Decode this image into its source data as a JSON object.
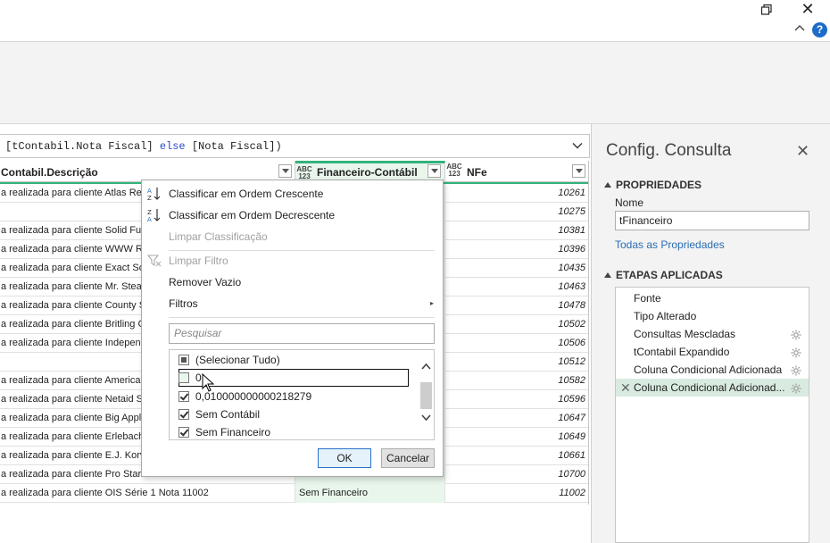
{
  "window": {
    "help_label": "?"
  },
  "formula": {
    "before": "[tContabil.Nota Fiscal] ",
    "keyword": "else",
    "after": " [Nota Fiscal])"
  },
  "grid": {
    "columns": [
      {
        "title": "Contabil.Descrição",
        "type": ""
      },
      {
        "title": "Financeiro-Contábil",
        "type_top": "ABC",
        "type_bottom": "123"
      },
      {
        "title": "NFe",
        "type_top": "ABC",
        "type_bottom": "123"
      }
    ],
    "rows": [
      {
        "desc": "a realizada para cliente Atlas Rea",
        "fin": "",
        "nfe": "10261"
      },
      {
        "desc": "",
        "fin": "",
        "nfe": "10275"
      },
      {
        "desc": "a realizada para cliente Solid Fut",
        "fin": "",
        "nfe": "10381"
      },
      {
        "desc": "a realizada para cliente WWW Re",
        "fin": "",
        "nfe": "10396"
      },
      {
        "desc": "a realizada para cliente Exact Sol",
        "fin": "",
        "nfe": "10435"
      },
      {
        "desc": "a realizada para cliente Mr. Stea",
        "fin": "",
        "nfe": "10463"
      },
      {
        "desc": "a realizada para cliente County S",
        "fin": "",
        "nfe": "10478"
      },
      {
        "desc": "a realizada para cliente Britling C",
        "fin": "",
        "nfe": "10502"
      },
      {
        "desc": "a realizada para cliente Independ",
        "fin": "",
        "nfe": "10506"
      },
      {
        "desc": "",
        "fin": "",
        "nfe": "10512"
      },
      {
        "desc": "a realizada para cliente American",
        "fin": "",
        "nfe": "10582"
      },
      {
        "desc": "a realizada para cliente Netaid S",
        "fin": "",
        "nfe": "10596"
      },
      {
        "desc": "a realizada para cliente Big Apple",
        "fin": "",
        "nfe": "10647"
      },
      {
        "desc": "a realizada para cliente Erlebach",
        "fin": "",
        "nfe": "10649"
      },
      {
        "desc": "a realizada para cliente E.J. Korv",
        "fin": "",
        "nfe": "10661"
      },
      {
        "desc": "a realizada para cliente Pro Star",
        "fin": "",
        "nfe": "10700"
      },
      {
        "desc": "a realizada para cliente OIS Série 1 Nota 11002",
        "fin": "Sem Financeiro",
        "nfe": "11002"
      }
    ]
  },
  "menu": {
    "sort_asc": "Classificar em Ordem Crescente",
    "sort_desc": "Classificar em Ordem Decrescente",
    "clear_sort": "Limpar Classificação",
    "clear_filter": "Limpar Filtro",
    "remove_empty": "Remover Vazio",
    "filters": "Filtros",
    "search_placeholder": "Pesquisar",
    "list": [
      {
        "label": "(Selecionar Tudo)",
        "state": "partial"
      },
      {
        "label": "0",
        "state": "unchecked"
      },
      {
        "label": "0,010000000000218279",
        "state": "checked"
      },
      {
        "label": "Sem Contábil",
        "state": "checked"
      },
      {
        "label": "Sem Financeiro",
        "state": "checked"
      }
    ],
    "ok": "OK",
    "cancel": "Cancelar"
  },
  "query_settings": {
    "title": "Config. Consulta",
    "properties_header": "PROPRIEDADES",
    "name_label": "Nome",
    "name_value": "tFinanceiro",
    "all_properties": "Todas as Propriedades",
    "steps_header": "ETAPAS APLICADAS",
    "steps": [
      {
        "label": "Fonte",
        "gear": false,
        "active": false
      },
      {
        "label": "Tipo Alterado",
        "gear": false,
        "active": false
      },
      {
        "label": "Consultas Mescladas",
        "gear": true,
        "active": false
      },
      {
        "label": "tContabil Expandido",
        "gear": true,
        "active": false
      },
      {
        "label": "Coluna Condicional Adicionada",
        "gear": true,
        "active": false
      },
      {
        "label": "Coluna Condicional Adicionad...",
        "gear": true,
        "active": true
      }
    ]
  }
}
